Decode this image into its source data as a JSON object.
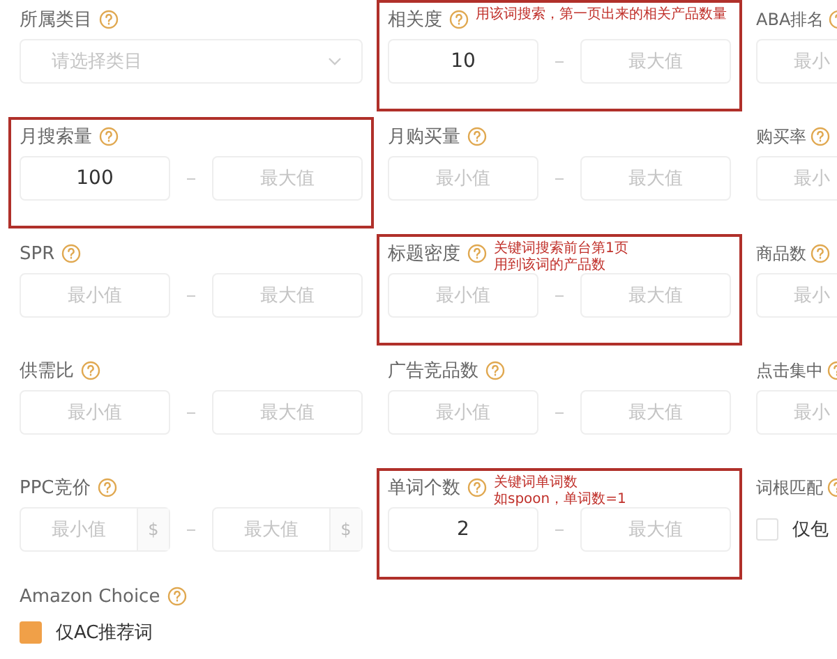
{
  "rows": [
    [
      {
        "kind": "select",
        "label": "所属类目",
        "placeholder": "请选择类目"
      },
      {
        "kind": "range",
        "label": "相关度",
        "min": {
          "value": "10"
        },
        "max": {
          "placeholder": "最大值"
        },
        "outlined": true,
        "note": [
          "用该词搜索，第一页出来的相关产品数量"
        ]
      },
      {
        "kind": "partial",
        "label": "ABA排名",
        "min": {
          "placeholder": "最小"
        }
      }
    ],
    [
      {
        "kind": "range",
        "label": "月搜索量",
        "min": {
          "value": "100"
        },
        "max": {
          "placeholder": "最大值"
        },
        "outlined": true
      },
      {
        "kind": "range",
        "label": "月购买量",
        "min": {
          "placeholder": "最小值"
        },
        "max": {
          "placeholder": "最大值"
        }
      },
      {
        "kind": "partial",
        "label": "购买率",
        "min": {
          "placeholder": "最小"
        }
      }
    ],
    [
      {
        "kind": "range",
        "label": "SPR",
        "min": {
          "placeholder": "最小值"
        },
        "max": {
          "placeholder": "最大值"
        }
      },
      {
        "kind": "range",
        "label": "标题密度",
        "min": {
          "placeholder": "最小值"
        },
        "max": {
          "placeholder": "最大值"
        },
        "outlined": true,
        "note": [
          "关键词搜索前台第1页",
          "用到该词的产品数"
        ]
      },
      {
        "kind": "partial",
        "label": "商品数",
        "min": {
          "placeholder": "最小"
        }
      }
    ],
    [
      {
        "kind": "range",
        "label": "供需比",
        "min": {
          "placeholder": "最小值"
        },
        "max": {
          "placeholder": "最大值"
        }
      },
      {
        "kind": "range",
        "label": "广告竞品数",
        "min": {
          "placeholder": "最小值"
        },
        "max": {
          "placeholder": "最大值"
        }
      },
      {
        "kind": "partial",
        "label": "点击集中",
        "min": {
          "placeholder": "最小"
        }
      }
    ],
    [
      {
        "kind": "currency",
        "label": "PPC竞价",
        "unit": "$",
        "min": {
          "placeholder": "最小值"
        },
        "max": {
          "placeholder": "最大值"
        }
      },
      {
        "kind": "range",
        "label": "单词个数",
        "min": {
          "value": "2"
        },
        "max": {
          "placeholder": "最大值"
        },
        "outlined": true,
        "note": [
          "关键词单词数",
          "如spoon，单词数=1"
        ]
      },
      {
        "kind": "checkbox",
        "label": "词根匹配",
        "option": "仅包",
        "checked": false
      }
    ]
  ],
  "amazon_choice": {
    "label": "Amazon Choice",
    "option": "仅AC推荐词",
    "checked": true
  }
}
